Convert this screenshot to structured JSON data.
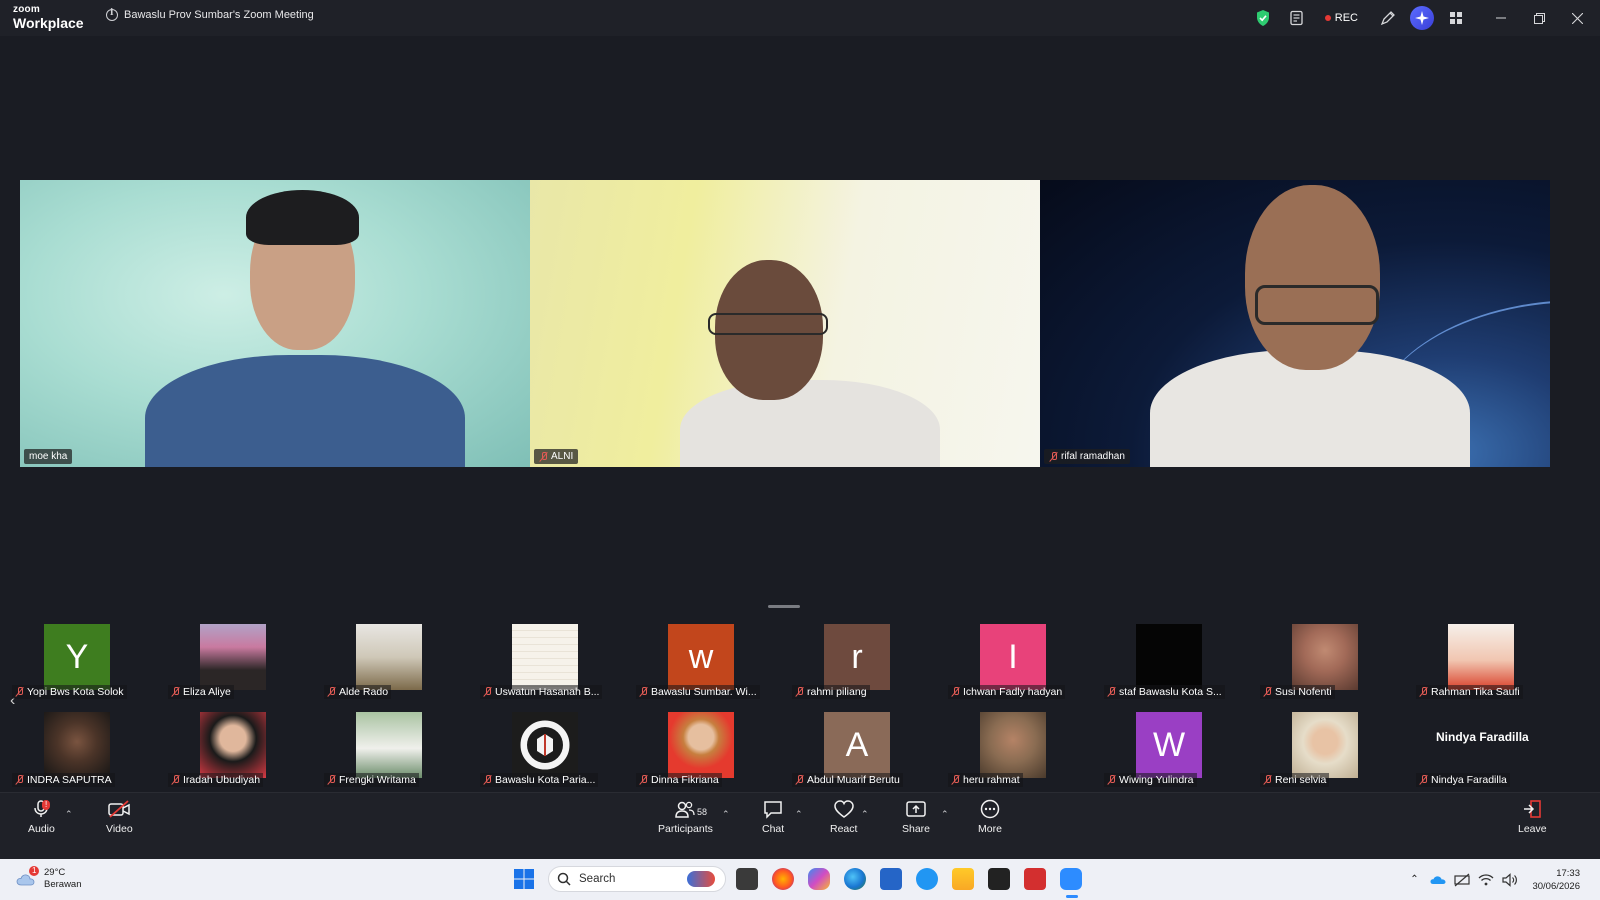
{
  "titlebar": {
    "logo_top": "zoom",
    "logo_bottom": "Workplace",
    "meeting_title": "Bawaslu Prov Sumbar's Zoom Meeting",
    "rec_label": "REC",
    "colors": {
      "shield": "#2ecc71",
      "rec": "#e53935",
      "ai": "#4a55f0"
    }
  },
  "videos": [
    {
      "name": "moe kha",
      "active": true,
      "muted": false
    },
    {
      "name": "ALNI",
      "active": false,
      "muted": true
    },
    {
      "name": "rifal ramadhan",
      "active": false,
      "muted": true
    }
  ],
  "gallery": {
    "row1": [
      {
        "name": "Yopi Bws Kota Solok",
        "initial": "Y",
        "color": "#3e7d1f"
      },
      {
        "name": "Eliza Aliye",
        "initial": "",
        "color": "#7c5a6c"
      },
      {
        "name": "Alde Rado",
        "initial": "",
        "color": "#8c7f6a"
      },
      {
        "name": "Uswatun Hasanah B...",
        "initial": "",
        "color": "#f1ece2"
      },
      {
        "name": "Bawaslu Sumbar. Wi...",
        "initial": "w",
        "color": "#c2461c"
      },
      {
        "name": "rahmi piliang",
        "initial": "r",
        "color": "#6e4a3e"
      },
      {
        "name": "Ichwan Fadly hadyan",
        "initial": "I",
        "color": "#e8427a"
      },
      {
        "name": "staf Bawaslu Kota S...",
        "initial": "",
        "color": "#050505"
      },
      {
        "name": "Susi Nofenti",
        "initial": "",
        "color": "#b87a6a"
      },
      {
        "name": "Rahman Tika Saufi",
        "initial": "",
        "color": "#f4efe9"
      }
    ],
    "row2": [
      {
        "name": "INDRA SAPUTRA",
        "initial": "",
        "color": "#2a2a2a"
      },
      {
        "name": "Iradah Ubudiyah",
        "initial": "",
        "color": "#d93a44"
      },
      {
        "name": "Frengki Writama",
        "initial": "",
        "color": "#8aa88c"
      },
      {
        "name": "Bawaslu Kota Paria...",
        "initial": "",
        "color": "#1c1c1c"
      },
      {
        "name": "Dinna Fikriana",
        "initial": "",
        "color": "#e53a2e"
      },
      {
        "name": "Abdul Muarif Berutu",
        "initial": "A",
        "color": "#8a6a58"
      },
      {
        "name": "heru rahmat",
        "initial": "",
        "color": "#8a6c52"
      },
      {
        "name": "Wiwing Yulindra",
        "initial": "W",
        "color": "#9a3fc4"
      },
      {
        "name": "Reni selvia",
        "initial": "",
        "color": "#d8c9b2"
      },
      {
        "name": "Nindya Faradilla",
        "initial": "",
        "color": "",
        "display_name": "Nindya Faradilla"
      }
    ]
  },
  "toolbar": {
    "audio": "Audio",
    "video": "Video",
    "participants": "Participants",
    "participants_count": "58",
    "chat": "Chat",
    "react": "React",
    "share": "Share",
    "more": "More",
    "leave": "Leave",
    "audio_badge": "!"
  },
  "taskbar": {
    "temp": "29°C",
    "weather": "Berawan",
    "weather_badge": "1",
    "search_placeholder": "Search",
    "time": "17:33",
    "date": "30/06/2026"
  }
}
